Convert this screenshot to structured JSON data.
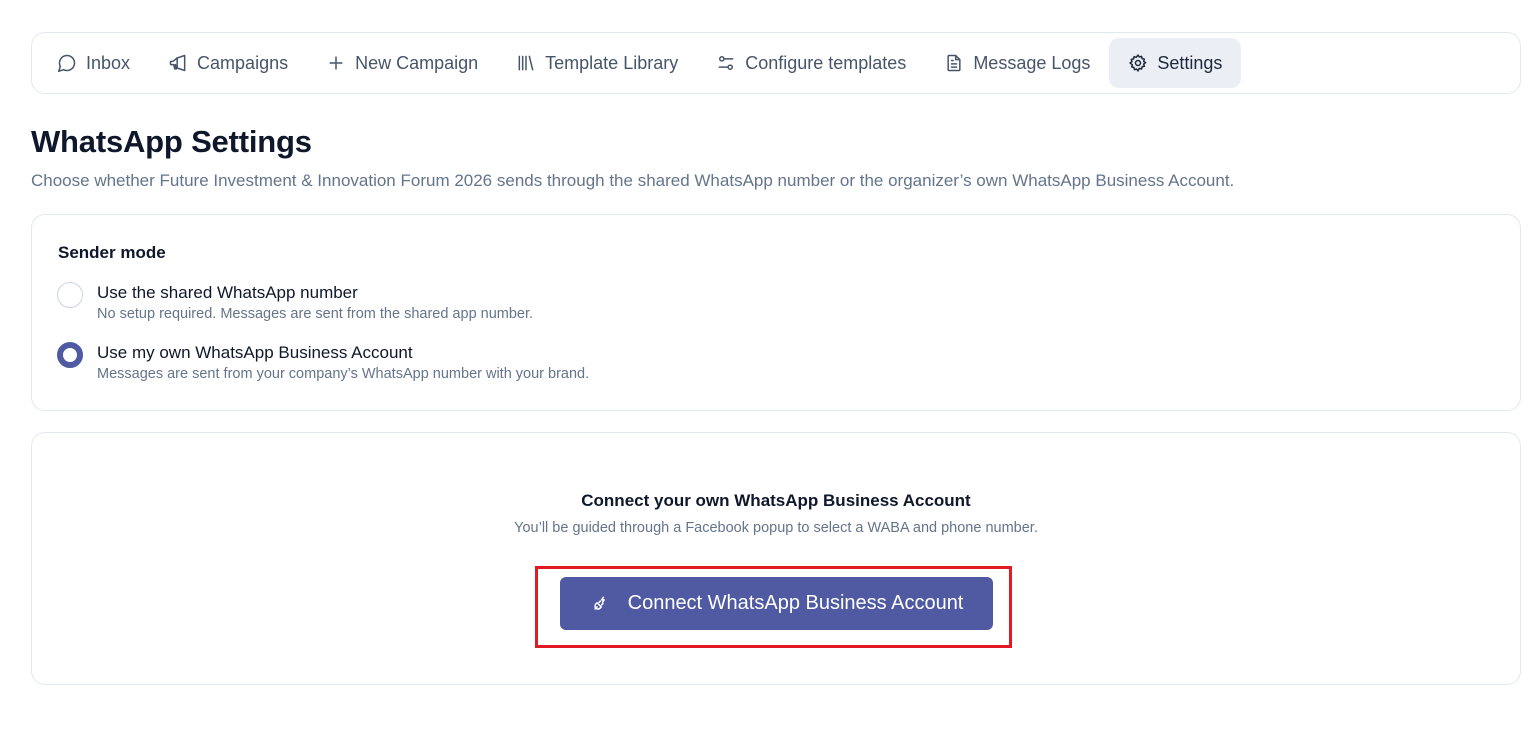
{
  "tabs": [
    {
      "label": "Inbox",
      "icon": "chat-bubble-icon"
    },
    {
      "label": "Campaigns",
      "icon": "megaphone-icon"
    },
    {
      "label": "New Campaign",
      "icon": "plus-icon"
    },
    {
      "label": "Template Library",
      "icon": "library-icon"
    },
    {
      "label": "Configure templates",
      "icon": "sliders-icon"
    },
    {
      "label": "Message Logs",
      "icon": "document-icon"
    },
    {
      "label": "Settings",
      "icon": "gear-icon",
      "active": true
    }
  ],
  "page": {
    "title": "WhatsApp Settings",
    "subtitle": "Choose whether Future Investment & Innovation Forum 2026 sends through the shared WhatsApp number or the organizer’s own WhatsApp Business Account."
  },
  "sender_mode": {
    "title": "Sender mode",
    "options": [
      {
        "label": "Use the shared WhatsApp number",
        "description": "No setup required. Messages are sent from the shared app number.",
        "selected": false
      },
      {
        "label": "Use my own WhatsApp Business Account",
        "description": "Messages are sent from your company’s WhatsApp number with your brand.",
        "selected": true
      }
    ]
  },
  "connect": {
    "title": "Connect your own WhatsApp Business Account",
    "description": "You’ll be guided through a Facebook popup to select a WABA and phone number.",
    "button_label": "Connect WhatsApp Business Account",
    "button_icon": "plug-icon"
  },
  "colors": {
    "accent": "#4f5aa3",
    "highlight": "#e01b24",
    "active_tab_bg": "#eceef5"
  }
}
